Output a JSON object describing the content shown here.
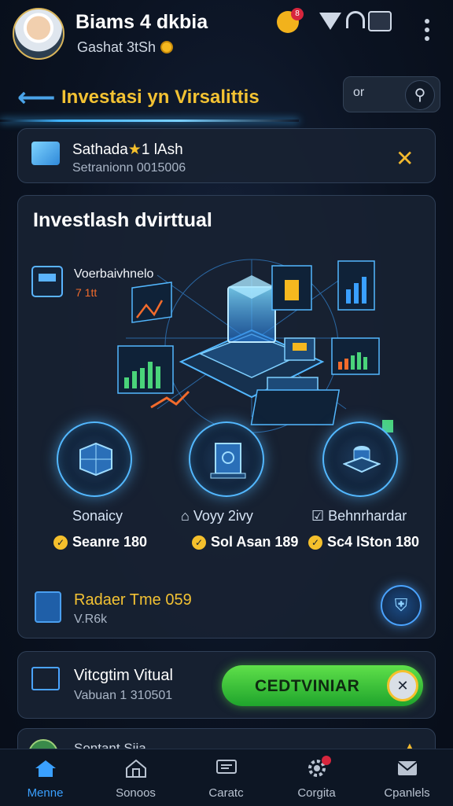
{
  "header": {
    "title": "Biams 4 dkbia",
    "subtitle": "Gashat 3tSh",
    "notification_badge": "8"
  },
  "nav": {
    "page_title": "Investasi yn Virsalittis",
    "tool_label": "or"
  },
  "notice_card": {
    "title": "Sathada",
    "title_suffix": "1 lAsh",
    "subtitle": "Setranionn  0015006"
  },
  "main_card": {
    "title": "Investlash dvirttual",
    "side_title": "Voerbaivhnelo",
    "side_value": "7 1tt",
    "orbs": [
      {
        "label": "Sonaicy",
        "value": "Seanre 180"
      },
      {
        "label": "Voyy 2ivy",
        "value": "Sol Asan 189"
      },
      {
        "label": "Behnrhardar",
        "value": "Sc4 lSton 180"
      }
    ],
    "ticket_title": "Radaer Tme 059",
    "ticket_sub": "V.R6k"
  },
  "action_card": {
    "title": "Vitcgtim Vitual",
    "subtitle": "Vabuan 1 310501",
    "cta_label": "CEDTVINIAR"
  },
  "peek_card": {
    "title": "Sontant Siia"
  },
  "bottom_nav": [
    {
      "label": "Menne",
      "icon": "home-icon",
      "active": true
    },
    {
      "label": "Sonoos",
      "icon": "store-icon",
      "active": false
    },
    {
      "label": "Caratc",
      "icon": "message-icon",
      "active": false
    },
    {
      "label": "Corgita",
      "icon": "settings-icon",
      "active": false
    },
    {
      "label": "Cpanlels",
      "icon": "mail-icon",
      "active": false
    }
  ],
  "colors": {
    "accent": "#3aa0ff",
    "highlight": "#f3c233",
    "cta": "#2fbf3a",
    "background": "#0b1322"
  }
}
